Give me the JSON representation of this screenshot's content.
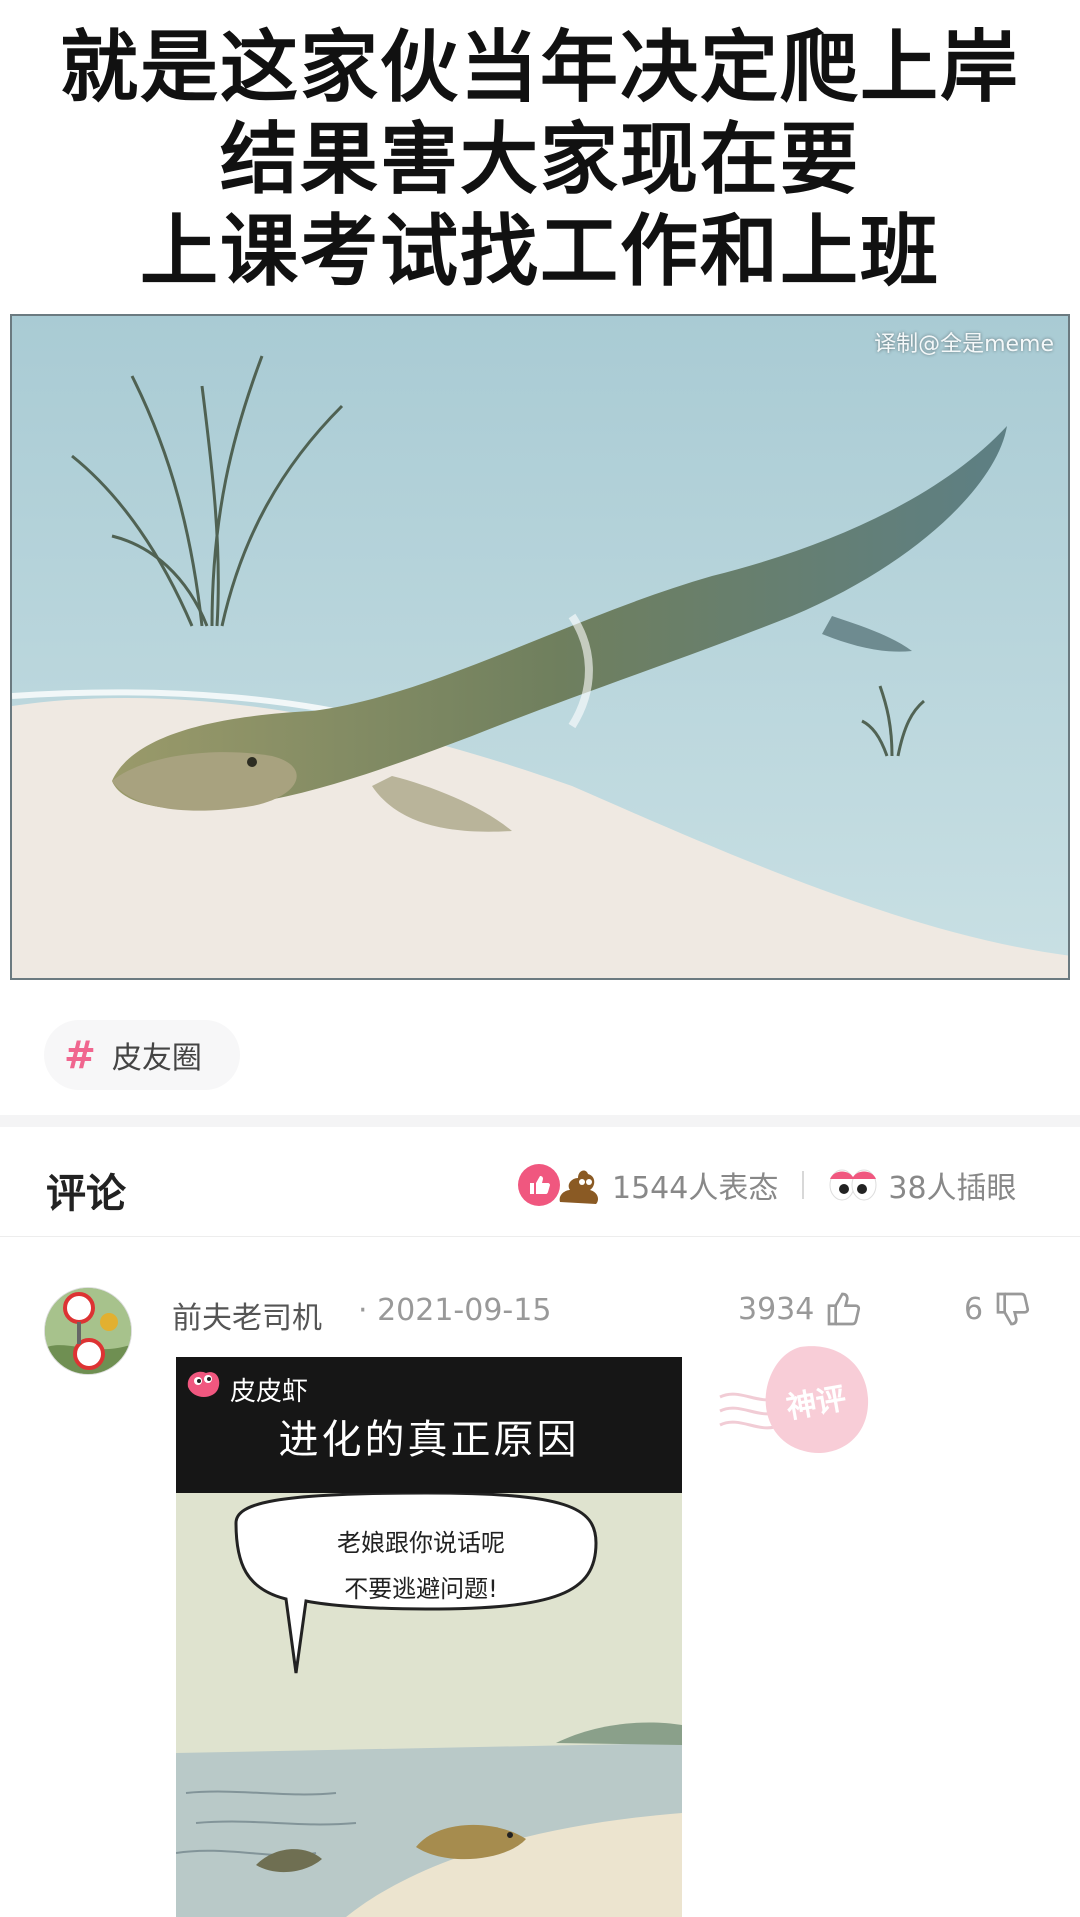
{
  "post": {
    "lines": [
      "就是这家伙当年决定爬上岸",
      "结果害大家现在要",
      "上课考试找工作和上班"
    ],
    "image_watermark": "译制@全是meme"
  },
  "topic": {
    "icon": "hash-icon",
    "label": "皮友圈"
  },
  "comments_section": {
    "title": "评论",
    "reactions_count": "1544人表态",
    "eyes_count": "38人插眼"
  },
  "comment": {
    "author": "前夫老司机",
    "date": "· 2021-09-15",
    "likes": "3934",
    "dislikes": "6",
    "badge": "神评",
    "comic": {
      "brand": "皮皮虾",
      "title": "进化的真正原因",
      "bubble_line1": "老娘跟你说话呢",
      "bubble_line2": "不要逃避问题!"
    }
  },
  "colors": {
    "accent": "#f0577f",
    "tag_hash": "#f0668f",
    "muted": "#999999"
  }
}
